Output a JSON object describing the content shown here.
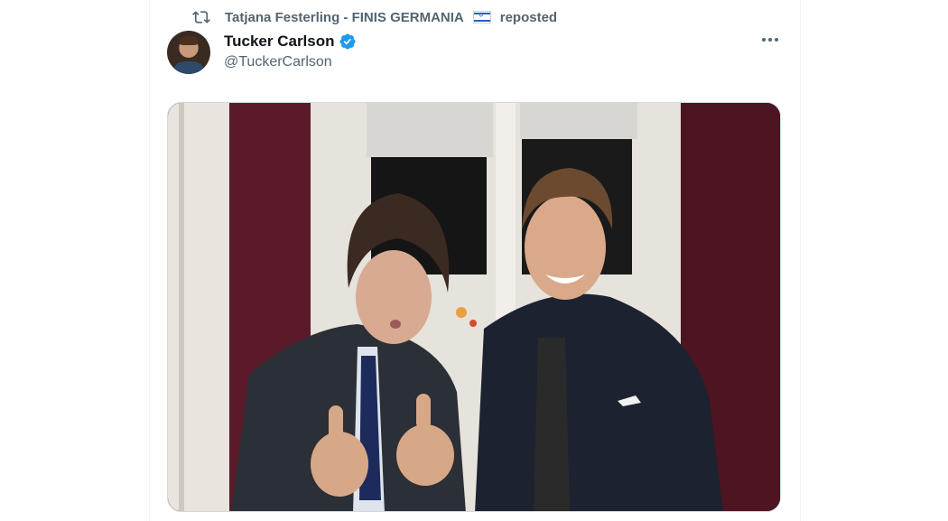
{
  "repost": {
    "user": "Tatjana Festerling - FINIS GERMANIA",
    "flag_icon": "israel-flag-emoji",
    "suffix": "reposted",
    "icon": "repost-icon"
  },
  "author": {
    "display_name": "Tucker Carlson",
    "handle": "@TuckerCarlson",
    "verified_icon": "verified-badge-icon",
    "verified_color": "#1d9bf0"
  },
  "more_icon": "more-horizontal-icon",
  "colors": {
    "secondary_text": "#536471",
    "primary_text": "#0f1419",
    "accent": "#1d9bf0"
  }
}
